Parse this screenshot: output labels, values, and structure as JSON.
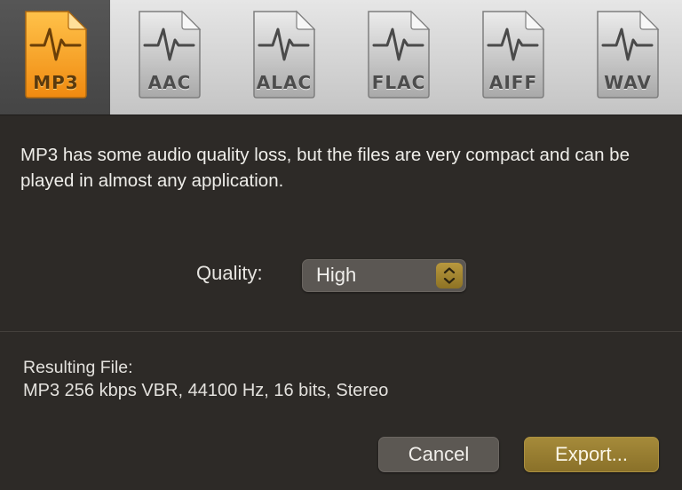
{
  "formats": [
    {
      "id": "mp3",
      "label": "MP3",
      "selected": true
    },
    {
      "id": "aac",
      "label": "AAC",
      "selected": false
    },
    {
      "id": "alac",
      "label": "ALAC",
      "selected": false
    },
    {
      "id": "flac",
      "label": "FLAC",
      "selected": false
    },
    {
      "id": "aiff",
      "label": "AIFF",
      "selected": false
    },
    {
      "id": "wav",
      "label": "WAV",
      "selected": false
    }
  ],
  "description": "MP3 has some audio quality loss, but the files are very compact and can be played in almost any application.",
  "quality": {
    "label": "Quality:",
    "value": "High"
  },
  "result": {
    "label": "Resulting File:",
    "value": "MP3 256 kbps VBR, 44100 Hz, 16 bits, Stereo"
  },
  "buttons": {
    "cancel": "Cancel",
    "export": "Export..."
  },
  "colors": {
    "accent_gold": "#a58a3a",
    "selected_icon": "#f5a623",
    "background": "#2d2a27"
  },
  "icons": {
    "file": "audio-file-icon",
    "waveform": "waveform-icon",
    "stepper": "up-down-chevron-icon"
  }
}
